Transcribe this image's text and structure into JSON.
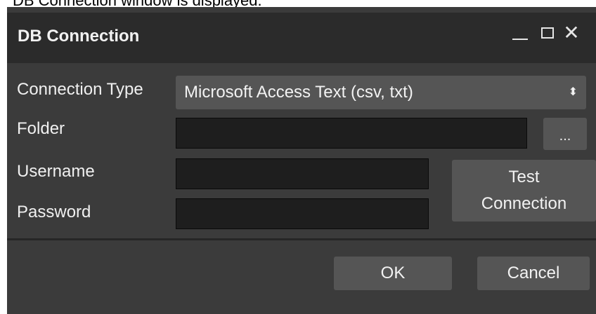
{
  "top_strip": {
    "text": "DB Connection window is displayed."
  },
  "window": {
    "title": "DB Connection",
    "controls": {
      "minimize_icon": "minimize-icon",
      "maximize_icon": "maximize-icon",
      "close_icon": "close-icon",
      "close_glyph": "✕"
    }
  },
  "form": {
    "connection_type": {
      "label": "Connection Type",
      "selected": "Microsoft Access Text (csv, txt)",
      "arrows_glyph": "⬍"
    },
    "folder": {
      "label": "Folder",
      "value": "",
      "browse_label": "..."
    },
    "username": {
      "label": "Username",
      "value": ""
    },
    "password": {
      "label": "Password",
      "value": ""
    },
    "test_connection_label_line1": "Test",
    "test_connection_label_line2": "Connection"
  },
  "footer": {
    "ok_label": "OK",
    "cancel_label": "Cancel"
  },
  "colors": {
    "window_bg": "#3b3b3b",
    "titlebar_bg": "#2b2b2b",
    "button_bg": "#555555",
    "input_bg": "#1e1e1e",
    "text": "#f2f2f2"
  }
}
